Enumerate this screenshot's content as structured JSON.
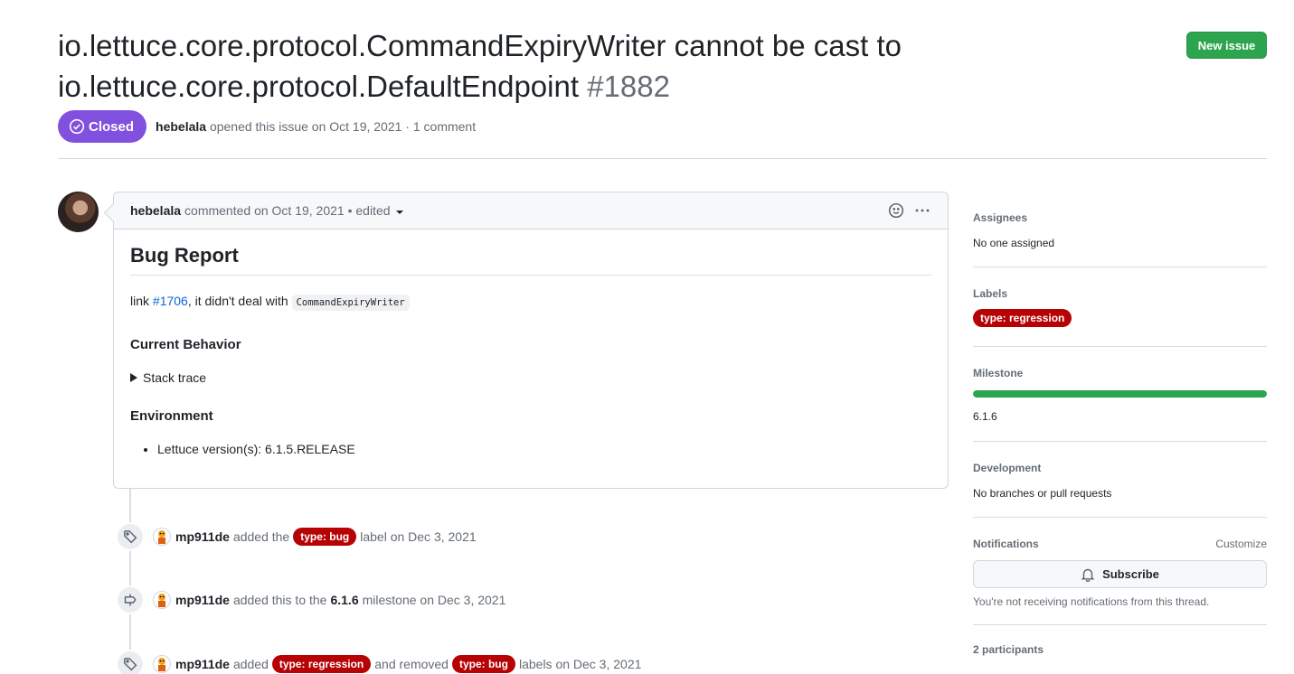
{
  "issue": {
    "title": "io.lettuce.core.protocol.CommandExpiryWriter cannot be cast to io.lettuce.core.protocol.DefaultEndpoint",
    "number": "#1882",
    "new_issue_label": "New issue",
    "state": "Closed",
    "author": "hebelala",
    "opened_text": "opened this issue on Oct 19, 2021 · 1 comment"
  },
  "comment": {
    "author": "hebelala",
    "meta": "commented on Oct 19, 2021 • edited",
    "heading": "Bug Report",
    "link_prefix": "link ",
    "link_text": "#1706",
    "link_suffix": ", it didn't deal with ",
    "code": "CommandExpiryWriter",
    "current_behavior": "Current Behavior",
    "stack_trace": "Stack trace",
    "environment": "Environment",
    "env_items": [
      "Lettuce version(s): 6.1.5.RELEASE"
    ]
  },
  "timeline": [
    {
      "icon": "tag-icon",
      "user": "mp911de",
      "pre": "added the",
      "label1": "type: bug",
      "mid": "",
      "label2": "",
      "post": "label on Dec 3, 2021"
    },
    {
      "icon": "milestone-icon",
      "user": "mp911de",
      "pre": "added this to the",
      "milestone": "6.1.6",
      "post": "milestone on Dec 3, 2021"
    },
    {
      "icon": "tag-icon",
      "user": "mp911de",
      "pre": "added",
      "label1": "type: regression",
      "mid": "and removed",
      "label2": "type: bug",
      "post": "labels on Dec 3, 2021"
    }
  ],
  "sidebar": {
    "assignees_title": "Assignees",
    "assignees_value": "No one assigned",
    "labels_title": "Labels",
    "label": "type: regression",
    "milestone_title": "Milestone",
    "milestone_progress": 1.0,
    "milestone_value": "6.1.6",
    "development_title": "Development",
    "development_value": "No branches or pull requests",
    "notifications_title": "Notifications",
    "customize": "Customize",
    "subscribe": "Subscribe",
    "notifications_note": "You're not receiving notifications from this thread.",
    "participants": "2 participants"
  },
  "colors": {
    "label_red": "#b60205",
    "closed_purple": "#8250df",
    "green": "#2da44e",
    "link_blue": "#0969da"
  }
}
